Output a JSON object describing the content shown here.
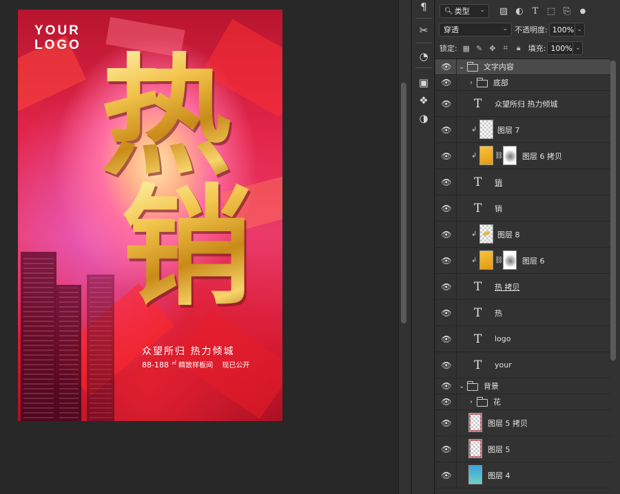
{
  "canvas": {
    "logo_line1": "YOUR",
    "logo_line2": "LOGO",
    "big_char_1": "热",
    "big_char_2": "销",
    "slogan": "众望所归  热力倾城",
    "price": "88-188",
    "price_unit": "㎡",
    "showroom": "精致样板间",
    "open_now": "现已公开"
  },
  "tool_strip": {
    "tools": [
      "paragraph-icon",
      "tool-options-icon",
      "history-icon",
      "artboard-icon",
      "3d-cubes-icon",
      "adjustments-icon"
    ]
  },
  "layers_panel": {
    "filter_kind_label": "类型",
    "blend_mode": "穿透",
    "opacity_label": "不透明度:",
    "opacity_value": "100%",
    "lock_label": "锁定:",
    "fill_label": "填充:",
    "fill_value": "100%",
    "layers": [
      {
        "name": "文字内容",
        "kind": "group",
        "expanded": true,
        "selected": true
      },
      {
        "name": "底部",
        "kind": "group",
        "expanded": false
      },
      {
        "name": "众望所归  热力倾城",
        "kind": "text"
      },
      {
        "name": "图层 7",
        "kind": "pixel"
      },
      {
        "name": "图层 6 拷贝",
        "kind": "pixel-mask"
      },
      {
        "name": "销",
        "kind": "text"
      },
      {
        "name": "销",
        "kind": "text"
      },
      {
        "name": "图层 8",
        "kind": "pixel"
      },
      {
        "name": "图层 6",
        "kind": "pixel-mask"
      },
      {
        "name": "热 拷贝",
        "kind": "text"
      },
      {
        "name": "热",
        "kind": "text"
      },
      {
        "name": "logo",
        "kind": "text"
      },
      {
        "name": "your",
        "kind": "text"
      },
      {
        "name": "背景",
        "kind": "group",
        "expanded": true
      },
      {
        "name": "花",
        "kind": "group",
        "expanded": false
      },
      {
        "name": "图层 5 拷贝",
        "kind": "pixel"
      },
      {
        "name": "图层 5",
        "kind": "pixel"
      },
      {
        "name": "图层 4",
        "kind": "pixel"
      }
    ]
  },
  "colors": {
    "panel_bg": "#323232",
    "app_bg": "#282828",
    "gold": "#e8b23a"
  }
}
